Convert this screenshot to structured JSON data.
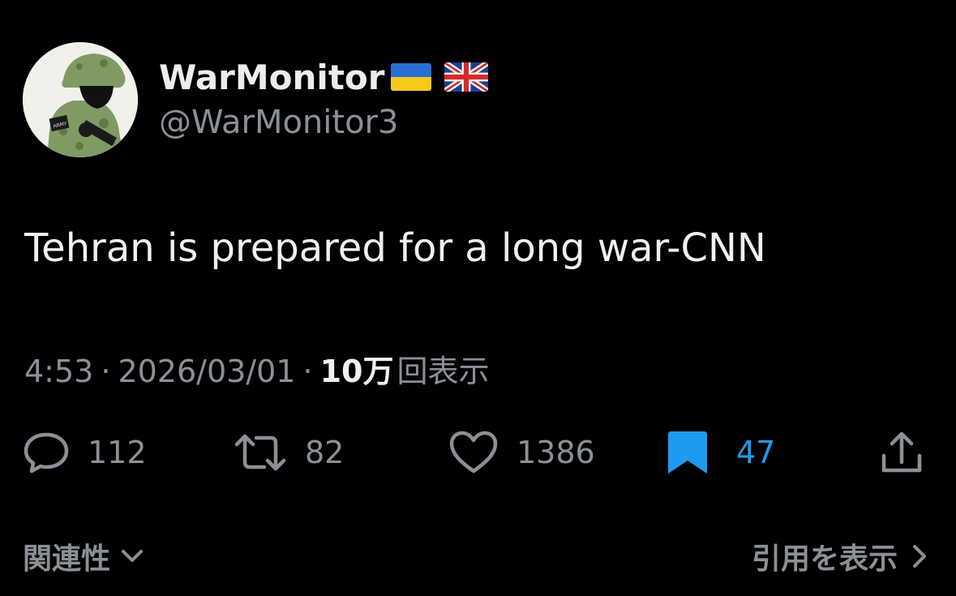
{
  "tweet": {
    "author": {
      "display_name": "WarMonitor",
      "handle": "@WarMonitor3",
      "flags": [
        "ukraine-flag-icon",
        "uk-flag-icon"
      ],
      "avatar_badge_text": "ARMY"
    },
    "text": "Tehran is prepared for a long war-CNN",
    "meta": {
      "time": "4:53",
      "separator": "·",
      "date": "2026/03/01",
      "views_count": "10万",
      "views_label": "回表示"
    },
    "actions": {
      "replies": "112",
      "retweets": "82",
      "likes": "1386",
      "bookmarks": "47"
    },
    "footer": {
      "related_label": "関連性",
      "quotes_label": "引用を表示"
    }
  },
  "colors": {
    "background": "#000000",
    "primary_text": "#f0f0f0",
    "secondary_text": "#8b9097",
    "bookmark_active": "#1d9bf0"
  }
}
